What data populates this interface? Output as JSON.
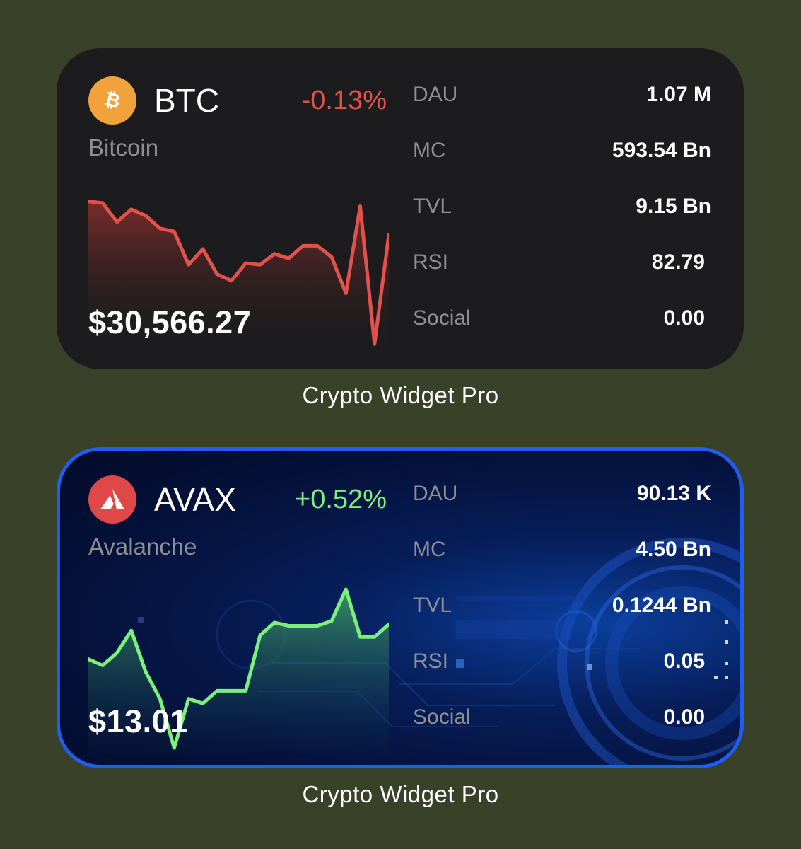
{
  "colors": {
    "background": "#3a4129",
    "negative": "#e2524a",
    "positive": "#7bf07b",
    "label": "#8e8e93",
    "btc_icon": "#f2a23a",
    "avax_icon": "#e04848",
    "selection_border": "#1f5ef0"
  },
  "widgets": [
    {
      "symbol": "BTC",
      "name": "Bitcoin",
      "change": "-0.13%",
      "price": "$30,566.27",
      "icon": "bitcoin-icon",
      "trend": "negative",
      "stats": [
        {
          "label": "DAU",
          "value": "1.07 M"
        },
        {
          "label": "MC",
          "value": "593.54 Bn"
        },
        {
          "label": "TVL",
          "value": "9.15 Bn"
        },
        {
          "label": "RSI",
          "value": "82.79"
        },
        {
          "label": "Social",
          "value": "0.00"
        }
      ],
      "caption": "Crypto Widget Pro"
    },
    {
      "symbol": "AVAX",
      "name": "Avalanche",
      "change": "+0.52%",
      "price": "$13.01",
      "icon": "avalanche-icon",
      "trend": "positive",
      "selected": true,
      "stats": [
        {
          "label": "DAU",
          "value": "90.13 K"
        },
        {
          "label": "MC",
          "value": "4.50 Bn"
        },
        {
          "label": "TVL",
          "value": "0.1244 Bn"
        },
        {
          "label": "RSI",
          "value": "0.05"
        },
        {
          "label": "Social",
          "value": "0.00"
        }
      ],
      "caption": "Crypto Widget Pro"
    }
  ],
  "chart_data": [
    {
      "type": "area",
      "series": [
        {
          "values": [
            0.93,
            0.92,
            0.8,
            0.88,
            0.84,
            0.76,
            0.74,
            0.53,
            0.63,
            0.47,
            0.43,
            0.54,
            0.53,
            0.6,
            0.57,
            0.65,
            0.65,
            0.58,
            0.35,
            0.9,
            0.03,
            0.72
          ]
        }
      ]
    },
    {
      "type": "area",
      "series": [
        {
          "values": [
            0.56,
            0.52,
            0.6,
            0.74,
            0.48,
            0.31,
            0.0,
            0.31,
            0.28,
            0.36,
            0.36,
            0.36,
            0.71,
            0.79,
            0.77,
            0.77,
            0.77,
            0.8,
            1.0,
            0.7,
            0.7,
            0.78
          ]
        }
      ]
    }
  ]
}
